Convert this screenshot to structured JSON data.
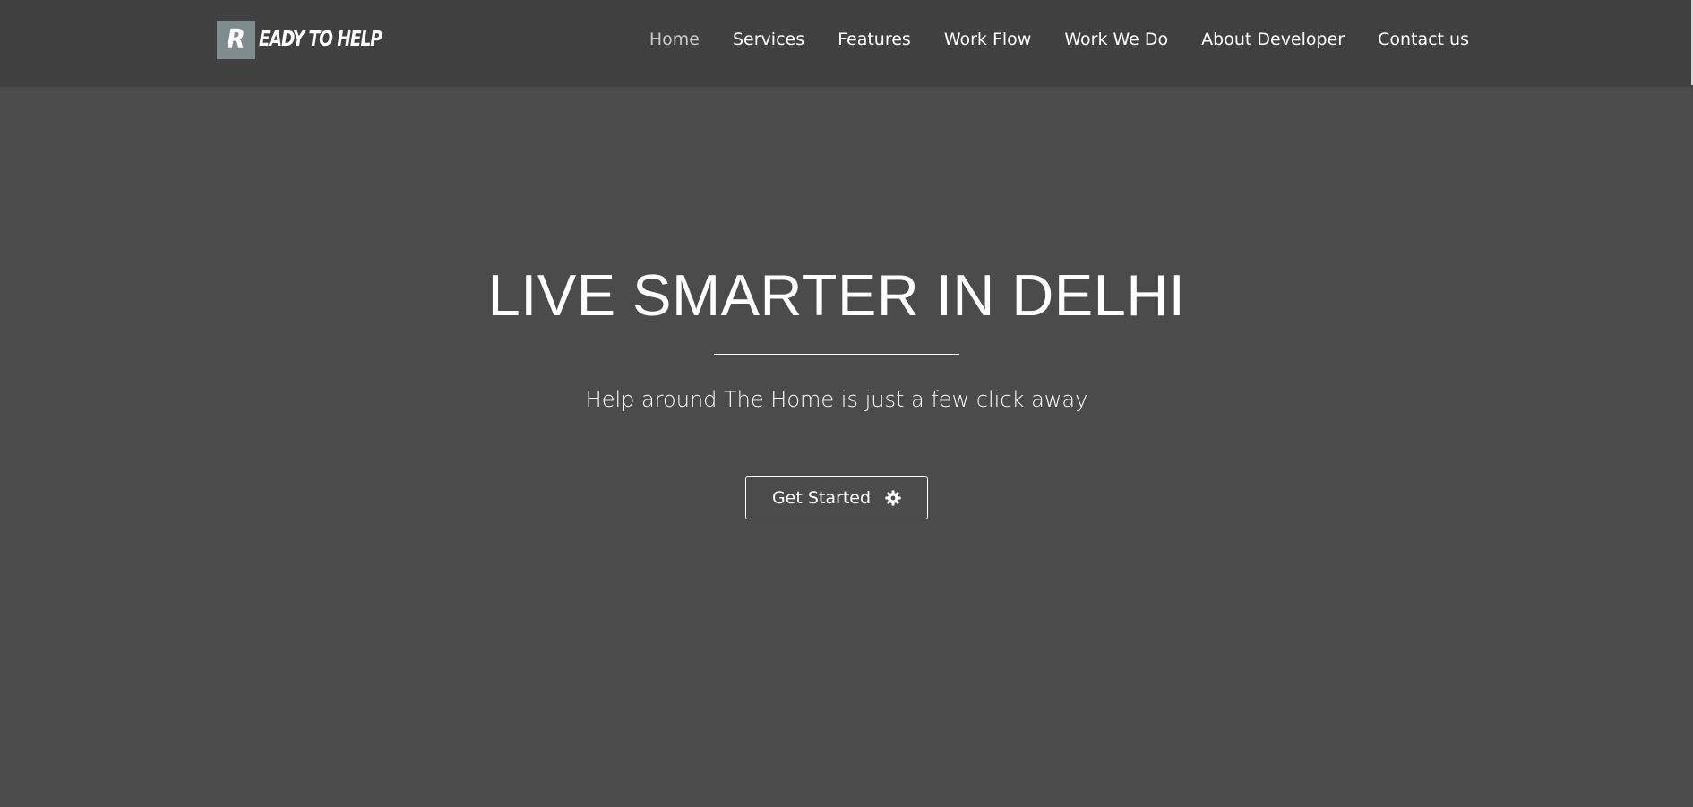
{
  "brand": {
    "initial": "R",
    "rest": "EADY TO HELP"
  },
  "nav": {
    "items": [
      {
        "label": "Home"
      },
      {
        "label": "Services"
      },
      {
        "label": "Features"
      },
      {
        "label": "Work Flow"
      },
      {
        "label": "Work We Do"
      },
      {
        "label": "About Developer"
      },
      {
        "label": "Contact us"
      }
    ]
  },
  "hero": {
    "title": "LIVE SMARTER IN DELHI",
    "subtitle": "Help around The Home is just a few click away",
    "cta_label": "Get Started",
    "cta_icon": "gear-icon"
  },
  "colors": {
    "background": "#4b4b4b",
    "navbar": "#404040",
    "brand_box": "#7f8c8d",
    "text": "#ffffff",
    "nav_active": "#c9c9c9"
  }
}
